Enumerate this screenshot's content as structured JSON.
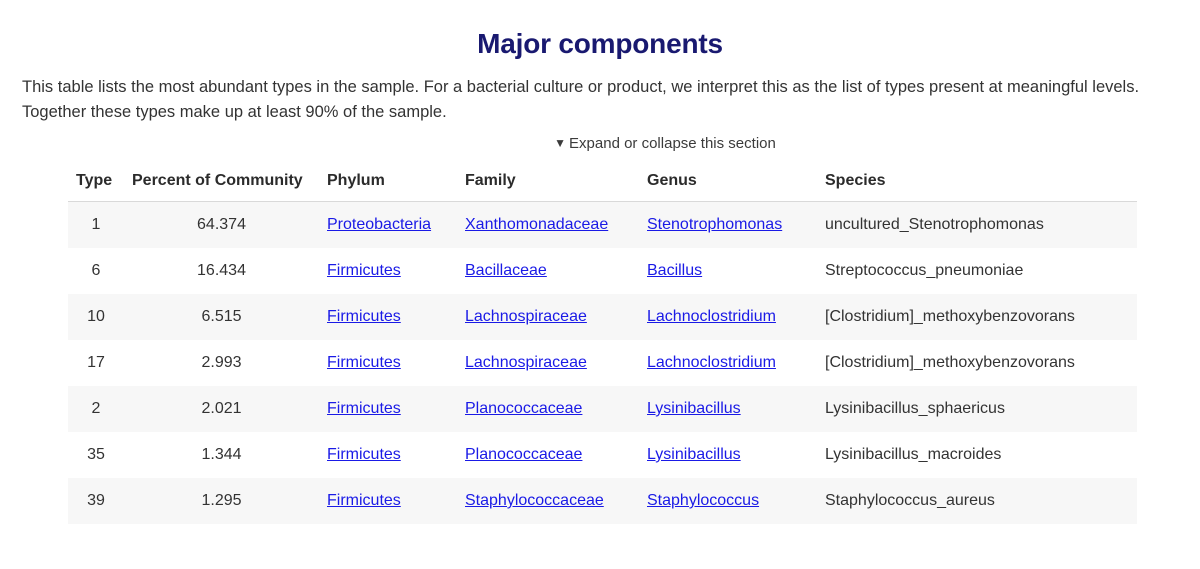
{
  "header": {
    "title": "Major components",
    "description": "This table lists the most abundant types in the sample. For a bacterial culture or product, we interpret this as the list of types present at meaningful levels. Together these types make up at least 90% of the sample."
  },
  "expand_toggle": {
    "caret": "▼",
    "label": "Expand or collapse this section"
  },
  "colors": {
    "title": "#191970",
    "link": "#1a1ae6",
    "body_text": "#333333",
    "row_stripe": "#f7f7f7",
    "header_border": "#d9d9d9"
  },
  "table": {
    "columns": [
      {
        "key": "type",
        "label": "Type",
        "align": "center",
        "link": false
      },
      {
        "key": "percent",
        "label": "Percent of Community",
        "align": "center",
        "link": false
      },
      {
        "key": "phylum",
        "label": "Phylum",
        "align": "left",
        "link": true
      },
      {
        "key": "family",
        "label": "Family",
        "align": "left",
        "link": true
      },
      {
        "key": "genus",
        "label": "Genus",
        "align": "left",
        "link": true
      },
      {
        "key": "species",
        "label": "Species",
        "align": "left",
        "link": false
      }
    ],
    "rows": [
      {
        "type": "1",
        "percent": "64.374",
        "phylum": "Proteobacteria",
        "family": "Xanthomonadaceae",
        "genus": "Stenotrophomonas",
        "species": "uncultured_Stenotrophomonas"
      },
      {
        "type": "6",
        "percent": "16.434",
        "phylum": "Firmicutes",
        "family": "Bacillaceae",
        "genus": "Bacillus",
        "species": "Streptococcus_pneumoniae"
      },
      {
        "type": "10",
        "percent": "6.515",
        "phylum": "Firmicutes",
        "family": "Lachnospiraceae",
        "genus": "Lachnoclostridium",
        "species": "[Clostridium]_methoxybenzovorans"
      },
      {
        "type": "17",
        "percent": "2.993",
        "phylum": "Firmicutes",
        "family": "Lachnospiraceae",
        "genus": "Lachnoclostridium",
        "species": "[Clostridium]_methoxybenzovorans"
      },
      {
        "type": "2",
        "percent": "2.021",
        "phylum": "Firmicutes",
        "family": "Planococcaceae",
        "genus": "Lysinibacillus",
        "species": "Lysinibacillus_sphaericus"
      },
      {
        "type": "35",
        "percent": "1.344",
        "phylum": "Firmicutes",
        "family": "Planococcaceae",
        "genus": "Lysinibacillus",
        "species": "Lysinibacillus_macroides"
      },
      {
        "type": "39",
        "percent": "1.295",
        "phylum": "Firmicutes",
        "family": "Staphylococcaceae",
        "genus": "Staphylococcus",
        "species": "Staphylococcus_aureus"
      }
    ]
  }
}
